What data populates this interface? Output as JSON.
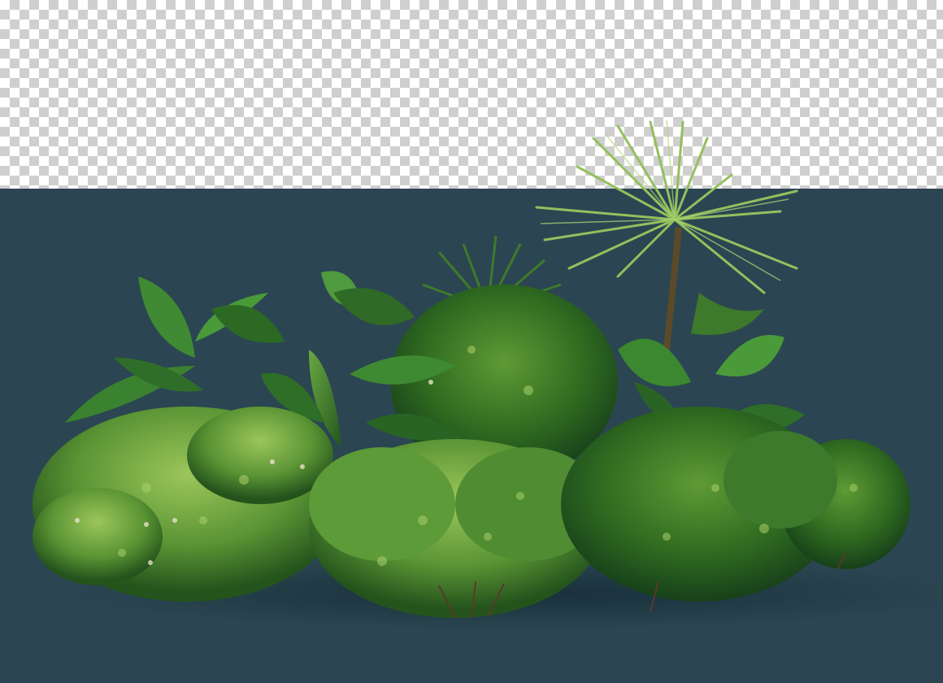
{
  "scene": {
    "description_colors": {
      "backdrop": "#2b4652",
      "checker_light": "#ffffff",
      "checker_dark": "#cfcfcf",
      "leaf_dark": "#1f4a1a",
      "leaf_mid": "#3f7a2a",
      "leaf_light": "#7fb04a",
      "palm": "#8fb85a"
    },
    "icons": [
      "plant-cluster",
      "palm-tree",
      "transparency-checkerboard"
    ]
  }
}
